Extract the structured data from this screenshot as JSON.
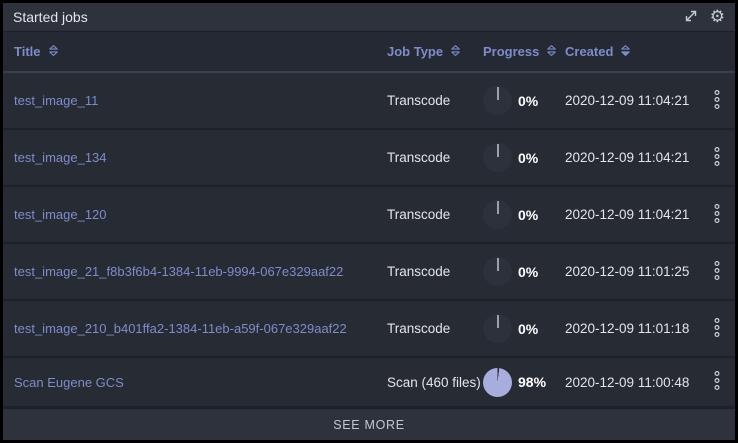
{
  "panel": {
    "title": "Started jobs",
    "icons": {
      "expand": "expand-icon",
      "settings": "gear-icon"
    }
  },
  "table": {
    "columns": [
      {
        "key": "title",
        "label": "Title",
        "sort": "none"
      },
      {
        "key": "job_type",
        "label": "Job Type",
        "sort": "none"
      },
      {
        "key": "progress",
        "label": "Progress",
        "sort": "none"
      },
      {
        "key": "created",
        "label": "Created",
        "sort": "desc"
      }
    ],
    "rows": [
      {
        "title": "test_image_11",
        "job_type": "Transcode",
        "progress_pct": 0,
        "progress_label": "0%",
        "created": "2020-12-09 11:04:21"
      },
      {
        "title": "test_image_134",
        "job_type": "Transcode",
        "progress_pct": 0,
        "progress_label": "0%",
        "created": "2020-12-09 11:04:21"
      },
      {
        "title": "test_image_120",
        "job_type": "Transcode",
        "progress_pct": 0,
        "progress_label": "0%",
        "created": "2020-12-09 11:04:21"
      },
      {
        "title": "test_image_21_f8b3f6b4-1384-11eb-9994-067e329aaf22",
        "job_type": "Transcode",
        "progress_pct": 0,
        "progress_label": "0%",
        "created": "2020-12-09 11:01:25"
      },
      {
        "title": "test_image_210_b401ffa2-1384-11eb-a59f-067e329aaf22",
        "job_type": "Transcode",
        "progress_pct": 0,
        "progress_label": "0%",
        "created": "2020-12-09 11:01:18"
      },
      {
        "title": "Scan Eugene GCS",
        "job_type": "Scan (460 files)",
        "progress_pct": 98,
        "progress_label": "98%",
        "created": "2020-12-09 11:00:48"
      }
    ]
  },
  "footer": {
    "see_more_label": "SEE MORE"
  },
  "colors": {
    "accent": "#7e8cca",
    "pie_fill": "#a7aedd",
    "pie_empty": "#262a33",
    "pie_zero_fill": "#2c313b",
    "icon_gray": "#c6c9cf"
  }
}
